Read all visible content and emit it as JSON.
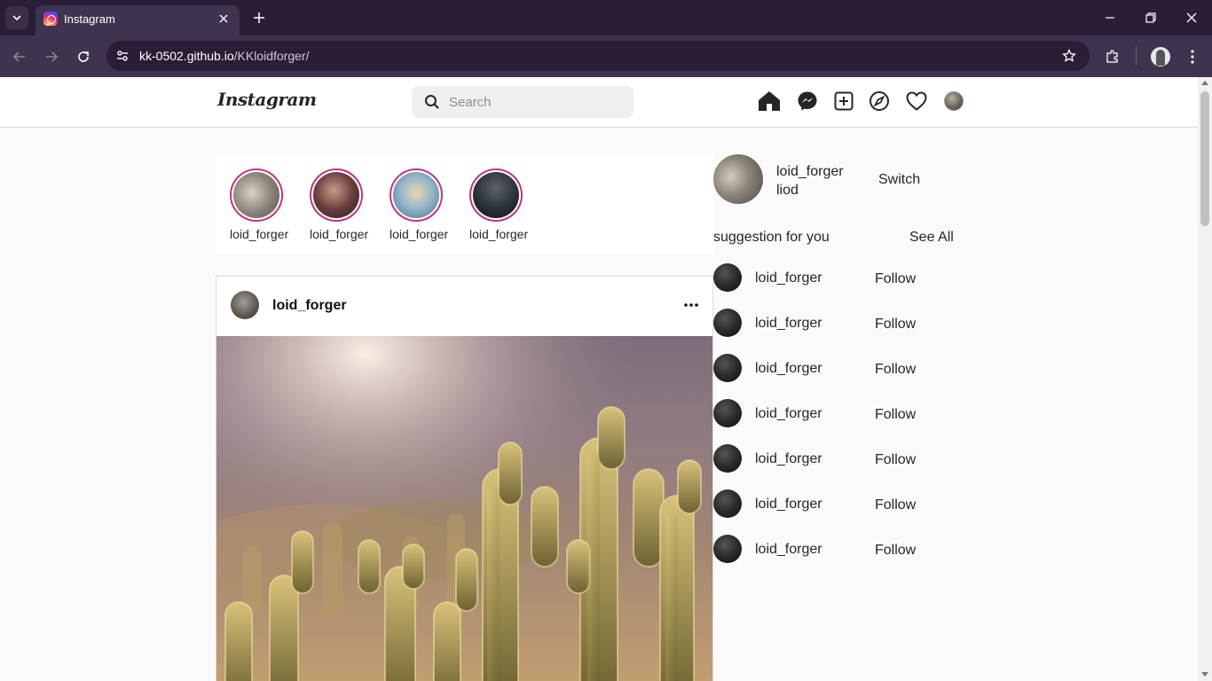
{
  "browser": {
    "tab_title": "Instagram",
    "url_host": "kk-0502.github.io",
    "url_path": "/KKloidforger/"
  },
  "header": {
    "logo_text": "Instagram",
    "search_placeholder": "Search",
    "nav_icons": [
      "home-icon",
      "messenger-icon",
      "new-post-icon",
      "explore-icon",
      "heart-icon",
      "profile-avatar"
    ]
  },
  "stories": [
    {
      "username": "loid_forger"
    },
    {
      "username": "loid_forger"
    },
    {
      "username": "loid_forger"
    },
    {
      "username": "loid_forger"
    }
  ],
  "post": {
    "username": "loid_forger",
    "image_subject": "cactus-in-sunlight"
  },
  "sidebar": {
    "me": {
      "username": "loid_forger",
      "name": "liod",
      "switch_label": "Switch"
    },
    "suggestions_title": "suggestion for you",
    "see_all_label": "See All",
    "suggestions": [
      {
        "username": "loid_forger",
        "action": "Follow"
      },
      {
        "username": "loid_forger",
        "action": "Follow"
      },
      {
        "username": "loid_forger",
        "action": "Follow"
      },
      {
        "username": "loid_forger",
        "action": "Follow"
      },
      {
        "username": "loid_forger",
        "action": "Follow"
      },
      {
        "username": "loid_forger",
        "action": "Follow"
      },
      {
        "username": "loid_forger",
        "action": "Follow"
      }
    ]
  },
  "colors": {
    "story_ring": "#c13584",
    "browser_frame": "#2b1d35",
    "browser_toolbar": "#3e3450"
  }
}
